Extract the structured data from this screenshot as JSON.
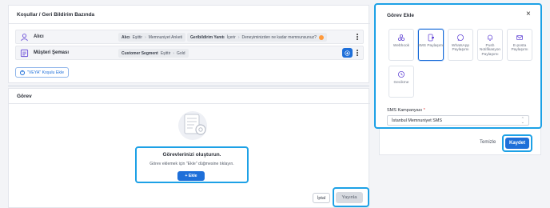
{
  "conditions": {
    "title": "Koşullar / Geri Bildirim Bazında",
    "rows": [
      {
        "name": "Alıcı",
        "pills": [
          {
            "key": "Alıcı",
            "parts": [
              "Eşittir",
              "Memnuniyet Anketi"
            ]
          },
          {
            "key": "Geribildirim Yanıtı",
            "parts": [
              "İçerir",
              "Deneyiminizden ne kadar memnunsunuz?"
            ]
          }
        ],
        "more_icon": "more-vertical-icon"
      },
      {
        "name": "Müşteri Şeması",
        "pills": [
          {
            "key": "Customer Segment",
            "parts": [
              "Eşittir",
              "Gold"
            ]
          }
        ],
        "more_icon": "more-vertical-icon"
      }
    ],
    "add_condition_label": "\"VEYA\" Koşulu Ekle"
  },
  "task": {
    "title": "Görev",
    "empty_title": "Görevlerinizi oluşturun.",
    "empty_text": "Görev eklemek için \"Ekle\" düğmesine tıklayın.",
    "add_button": "+ Ekle"
  },
  "footer": {
    "cancel": "İptal",
    "publish": "Yayınla"
  },
  "modal": {
    "title": "Görev Ekle",
    "close": "×",
    "tiles": [
      {
        "label": "Webhook",
        "icon": "webhook-icon",
        "selected": false
      },
      {
        "label": "SMS Paylaşımı",
        "icon": "sms-icon",
        "selected": true
      },
      {
        "label": "WhatsApp Paylaşımı",
        "icon": "whatsapp-icon",
        "selected": false
      },
      {
        "label": "Push Notifikasyon Paylaşımı",
        "icon": "push-notification-icon",
        "selected": false
      },
      {
        "label": "E-posta Paylaşımı",
        "icon": "email-icon",
        "selected": false
      },
      {
        "label": "Gecikme",
        "icon": "clock-icon",
        "selected": false
      }
    ],
    "campaign_label": "SMS Kampanyası",
    "required_mark": "*",
    "campaign_value": "İstanbul Memnuniyet SMS",
    "clear": "Temizle",
    "save": "Kaydet"
  },
  "colors": {
    "accent": "#1e6fd9",
    "highlight": "#1da1e6"
  }
}
